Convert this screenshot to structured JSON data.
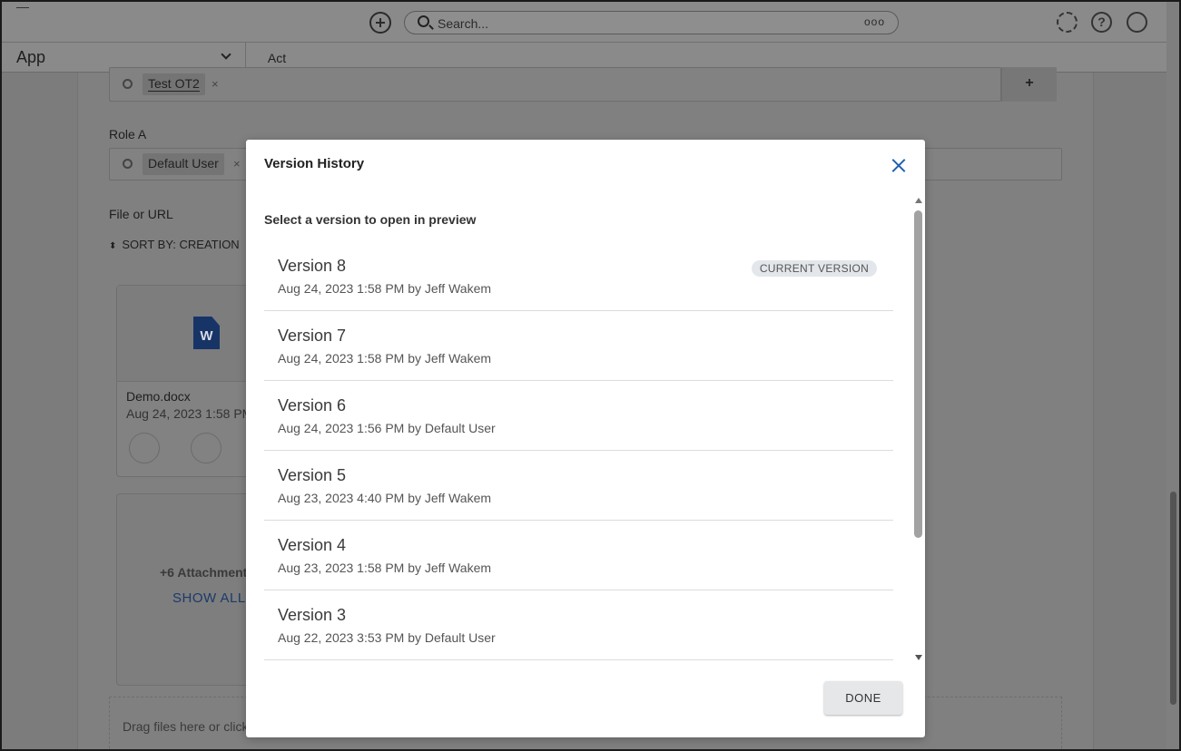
{
  "topbar": {
    "search_placeholder": "Search...",
    "search_more": "ooo",
    "help_icon_glyph": "?",
    "icons": [
      "add-circle-icon",
      "search-icon",
      "more-icon",
      "gear-icon",
      "help-icon",
      "user-icon"
    ]
  },
  "appbar": {
    "app_label": "App",
    "tab_label": "Act"
  },
  "background": {
    "tag_test": "Test OT2",
    "tag_remove": "×",
    "plus": "+",
    "role_label": "Role A",
    "tag_default_user": "Default User",
    "file_label": "File or URL",
    "sort_label": "SORT BY: CREATION",
    "file_name": "Demo.docx",
    "file_date": "Aug 24, 2023 1:58 PM",
    "attachments": "+6 Attachment",
    "show_all": "SHOW ALL",
    "drag_text": "Drag files here or click",
    "word_glyph": "W"
  },
  "modal": {
    "title": "Version History",
    "subtitle": "Select a version to open in preview",
    "current_badge": "CURRENT VERSION",
    "done_label": "DONE",
    "versions": [
      {
        "name": "Version 8",
        "meta": "Aug 24, 2023 1:58 PM by Jeff Wakem"
      },
      {
        "name": "Version 7",
        "meta": "Aug 24, 2023 1:58 PM by Jeff Wakem"
      },
      {
        "name": "Version 6",
        "meta": "Aug 24, 2023 1:56 PM by Default User"
      },
      {
        "name": "Version 5",
        "meta": "Aug 23, 2023 4:40 PM by Jeff Wakem"
      },
      {
        "name": "Version 4",
        "meta": "Aug 23, 2023 1:58 PM by Jeff Wakem"
      },
      {
        "name": "Version 3",
        "meta": "Aug 22, 2023 3:53 PM by Default User"
      }
    ]
  },
  "colors": {
    "accent": "#1f5fb0",
    "overlay": "#7c7c7c",
    "badge_bg": "#e3e6ea"
  }
}
